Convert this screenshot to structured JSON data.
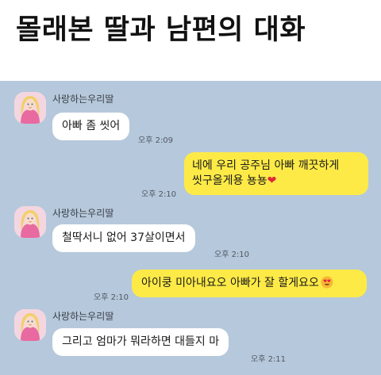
{
  "title": "몰래본 딸과 남편의 대화",
  "sender_name": "사랑하는우리딸",
  "messages": [
    {
      "from": "daughter",
      "text": "아빠 좀 씻어",
      "time": "오후 2:09"
    },
    {
      "from": "father",
      "line1": "네에 우리 공주님 아빠 깨끗하게",
      "line2": "씻구올게용 뇽뇽",
      "emoji": "❤",
      "time": "오후 2:10"
    },
    {
      "from": "daughter",
      "text": "철딱서니 없어 37살이면서",
      "time": "오후 2:10"
    },
    {
      "from": "father",
      "text": "아이쿵 미아내요오 아빠가 잘 할게요오",
      "emoji_icon": "heart-eyes-face-icon",
      "time": "오후 2:10"
    },
    {
      "from": "daughter",
      "text": "그리고 엄마가 뭐라하면 대들지 마",
      "time": "오후 2:11"
    }
  ],
  "colors": {
    "chat_background": "#b6c8db",
    "incoming_bubble": "#ffffff",
    "outgoing_bubble": "#fdea47"
  }
}
